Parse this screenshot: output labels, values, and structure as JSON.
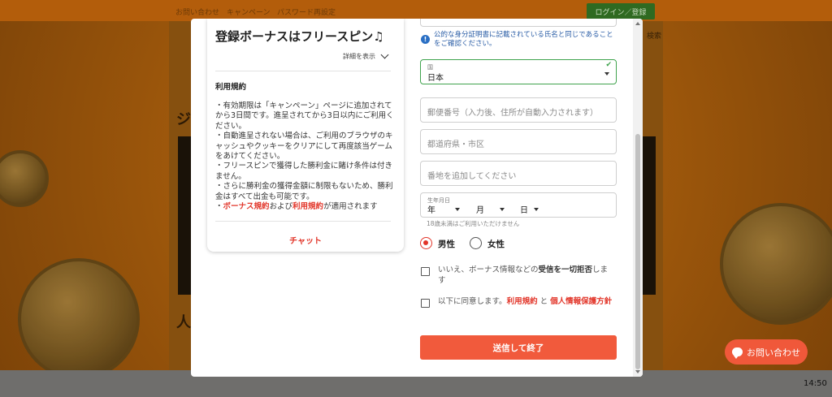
{
  "background": {
    "top_links": [
      "お問い合わせ",
      "キャンペーン",
      "パスワード再設定"
    ],
    "login_button": "ログイン／登録",
    "search_text": "検索",
    "section_letters": [
      "ジ",
      "人"
    ],
    "contact_button": "お問い合わせ",
    "clock": "14:50"
  },
  "bonus": {
    "title": "登録ボーナスはフリースピン♫",
    "detail_toggle": "詳細を表示",
    "terms_heading": "利用規約",
    "terms_lines": [
      "・有効期限は「キャンペーン」ページに追加されてから3日間です。進呈されてから3日以内にご利用ください。",
      "・自動進呈されない場合は、ご利用のブラウザのキャッシュやクッキーをクリアにして再度該当ゲームをあけてください。",
      "・フリースピンで獲得した勝利金に賭け条件は付きません。",
      "・さらに勝利金の獲得金額に制限もないため、勝利金はすべて出金も可能です。"
    ],
    "terms_last": {
      "prefix": "・",
      "link1": "ボーナス規約",
      "mid": "および",
      "link2": "利用規約",
      "suffix": "が適用されます"
    },
    "chat_link": "チャット"
  },
  "form": {
    "notice": "公的な身分証明書に記載されている氏名と同じであることをご確認ください。",
    "country_label": "国",
    "country_value": "日本",
    "postal_placeholder": "郵便番号（入力後、住所が自動入力されます）",
    "prefecture_placeholder": "都道府県・市区",
    "address_placeholder": "番地を追加してください",
    "dob_label": "生年月日",
    "dob_year": "年",
    "dob_month": "月",
    "dob_day": "日",
    "age_hint": "18歳未満はご利用いただけません",
    "gender_male": "男性",
    "gender_female": "女性",
    "opt_out_pre": "いいえ、ボーナス情報などの",
    "opt_out_bold": "受信を一切拒否",
    "opt_out_post": "します",
    "agree_pre": "以下に同意します。",
    "agree_link1": "利用規約",
    "agree_mid": " と ",
    "agree_link2": "個人情報保護方針",
    "submit": "送信して終了"
  },
  "colors": {
    "accent_red": "#e2362a",
    "submit_bg": "#f15a3c",
    "valid_green": "#3fa34d",
    "notice_blue": "#2a5da6"
  },
  "icons": [
    "info-icon",
    "check-icon",
    "chevron-down-icon",
    "chat-bubble-icon"
  ]
}
